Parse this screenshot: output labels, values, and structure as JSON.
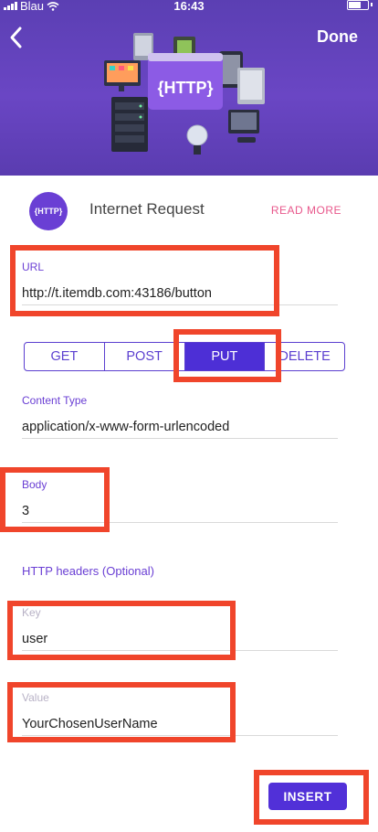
{
  "status_bar": {
    "carrier": "Blau",
    "time": "16:43"
  },
  "header": {
    "done_label": "Done",
    "illustration_badge": "{HTTP}"
  },
  "app": {
    "logo_text": "{HTTP}",
    "title": "Internet Request",
    "read_more": "READ MORE"
  },
  "url": {
    "label": "URL",
    "value": "http://t.itemdb.com:43186/button"
  },
  "methods": {
    "items": [
      "GET",
      "POST",
      "PUT",
      "DELETE"
    ],
    "selected": "PUT"
  },
  "content_type": {
    "label": "Content Type",
    "value": "application/x-www-form-urlencoded"
  },
  "body_field": {
    "label": "Body",
    "value": "3"
  },
  "headers": {
    "title": "HTTP headers (Optional)",
    "key_label": "Key",
    "key_value": "user",
    "value_label": "Value",
    "value_value": "YourChosenUserName"
  },
  "insert_label": "INSERT",
  "colors": {
    "accent": "#5130d8",
    "header": "#6a46c4",
    "highlight": "#f0452b",
    "link": "#e8578b"
  }
}
